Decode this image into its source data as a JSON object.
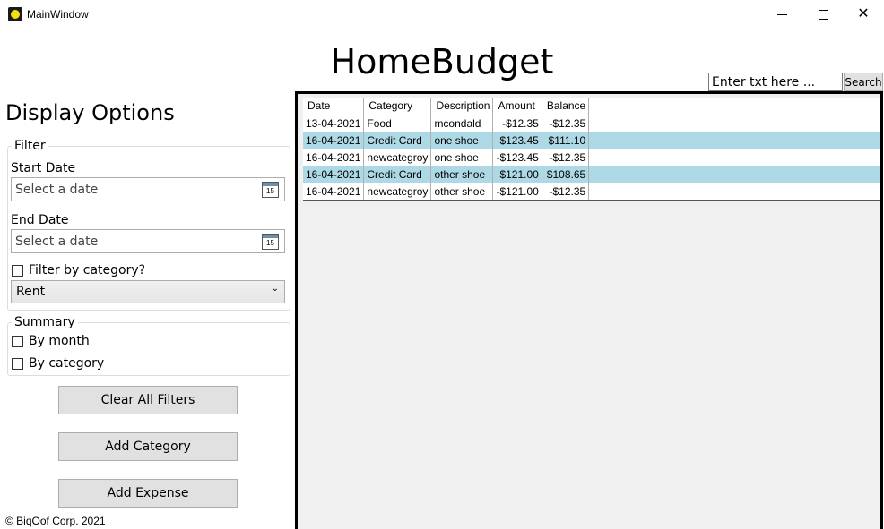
{
  "window": {
    "title": "MainWindow"
  },
  "app": {
    "heading": "HomeBudget"
  },
  "search": {
    "placeholder": "Enter txt here ...",
    "value": "Enter txt here ...",
    "button_label": "Search"
  },
  "display_options": {
    "title": "Display Options",
    "filter": {
      "legend": "Filter",
      "start_date_label": "Start Date",
      "start_date_placeholder": "Select a date",
      "end_date_label": "End Date",
      "end_date_placeholder": "Select a date",
      "calendar_icon_text": "15",
      "filter_by_category_label": "Filter by category?",
      "category_selected": "Rent"
    },
    "summary": {
      "legend": "Summary",
      "by_month_label": "By month",
      "by_category_label": "By category"
    }
  },
  "buttons": {
    "clear_filters": "Clear All Filters",
    "add_category": "Add Category",
    "add_expense": "Add Expense"
  },
  "footer": {
    "copyright": "© BiqOof Corp. 2021"
  },
  "grid": {
    "columns": [
      "Date",
      "Category",
      "Description",
      "Amount",
      "Balance"
    ],
    "rows": [
      {
        "date": "13-04-2021",
        "category": "Food",
        "description": "mcondald",
        "amount": "-$12.35",
        "balance": "-$12.35"
      },
      {
        "date": "16-04-2021",
        "category": "Credit Card",
        "description": "one shoe",
        "amount": "$123.45",
        "balance": "$111.10"
      },
      {
        "date": "16-04-2021",
        "category": "newcategroy",
        "description": "one shoe",
        "amount": "-$123.45",
        "balance": "-$12.35"
      },
      {
        "date": "16-04-2021",
        "category": "Credit Card",
        "description": "other shoe",
        "amount": "$121.00",
        "balance": "$108.65"
      },
      {
        "date": "16-04-2021",
        "category": "newcategroy",
        "description": "other shoe",
        "amount": "-$121.00",
        "balance": "-$12.35"
      }
    ],
    "alt_row_color": "#add8e6"
  }
}
